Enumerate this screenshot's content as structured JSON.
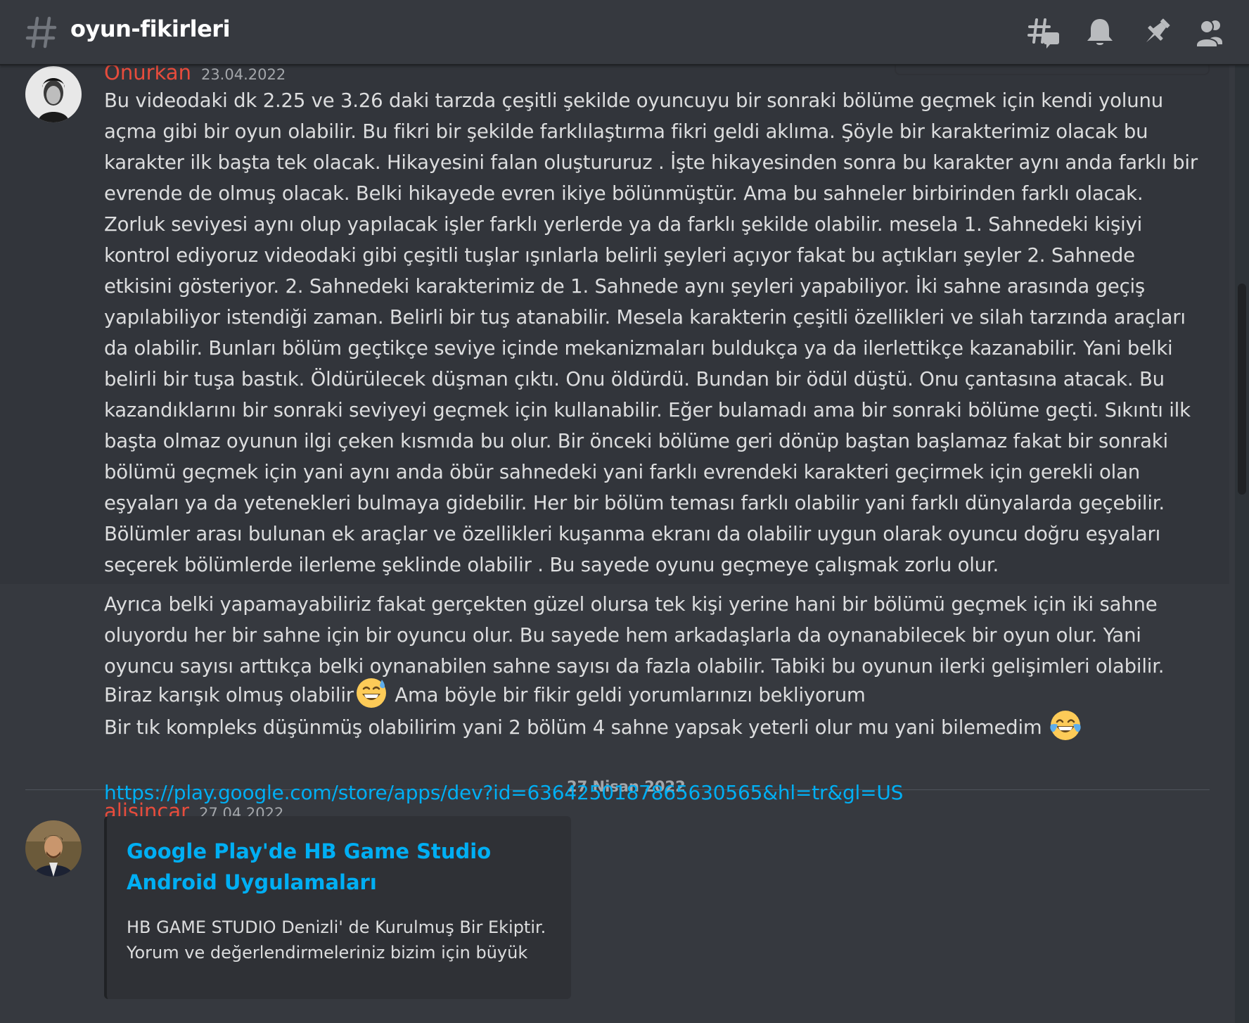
{
  "header": {
    "channel_name": "oyun-fikirleri",
    "icons": [
      "hash-icon",
      "threads-icon",
      "bell-icon",
      "pin-icon",
      "members-icon"
    ]
  },
  "messages": [
    {
      "author": "Onurkan",
      "timestamp": "23.04.2022",
      "paragraphs": [
        "Bu videodaki dk 2.25 ve 3.26 daki tarzda çeşitli şekilde oyuncuyu bir sonraki bölüme geçmek için kendi yolunu açma gibi bir oyun olabilir. Bu fikri bir şekilde farklılaştırma fikri geldi aklıma. Şöyle bir karakterimiz olacak bu karakter ilk başta tek olacak. Hikayesini falan oluştururuz . İşte hikayesinden sonra bu karakter aynı anda farklı bir evrende de olmuş olacak. Belki hikayede evren ikiye bölünmüştür.  Ama bu sahneler birbirinden farklı olacak. Zorluk seviyesi aynı olup yapılacak işler farklı yerlerde ya da farklı şekilde olabilir. mesela 1. Sahnedeki kişiyi kontrol ediyoruz videodaki gibi çeşitli tuşlar ışınlarla belirli şeyleri açıyor fakat bu açtıkları şeyler 2. Sahnede etkisini gösteriyor. 2. Sahnedeki karakterimiz de 1. Sahnede aynı şeyleri yapabiliyor. İki sahne arasında geçiş yapılabiliyor istendiği zaman. Belirli bir tuş atanabilir. Mesela karakterin çeşitli özellikleri ve silah tarzında araçları da olabilir. Bunları bölüm geçtikçe seviye içinde mekanizmaları buldukça ya da ilerlettikçe kazanabilir. Yani belki belirli bir tuşa bastık. Öldürülecek düşman çıktı. Onu öldürdü. Bundan bir ödül düştü. Onu çantasına atacak. Bu kazandıklarını bir sonraki seviyeyi geçmek için kullanabilir. Eğer bulamadı ama bir sonraki bölüme geçti. Sıkıntı ilk başta olmaz oyunun ilgi çeken kısmıda bu olur. Bir önceki bölüme geri dönüp baştan başlamaz fakat bir sonraki bölümü geçmek için yani aynı anda öbür sahnedeki yani farklı evrendeki karakteri geçirmek için gerekli olan eşyaları ya da yetenekleri bulmaya gidebilir. Her bir bölüm teması farklı olabilir yani farklı dünyalarda geçebilir. Bölümler arası bulunan ek araçlar ve özellikleri kuşanma ekranı da olabilir uygun olarak oyuncu doğru eşyaları seçerek bölümlerde ilerleme şeklinde olabilir . Bu sayede oyunu geçmeye çalışmak zorlu olur.",
        "Ayrıca belki yapamayabiliriz fakat gerçekten güzel olursa tek kişi yerine hani bir bölümü geçmek için iki sahne oluyordu her bir sahne için bir oyuncu olur. Bu sayede hem arkadaşlarla da oynanabilecek bir oyun olur. Yani oyuncu sayısı arttıkça belki oynanabilen sahne sayısı da fazla olabilir. Tabiki bu oyunun ilerki gelişimleri olabilir."
      ],
      "line_a": {
        "before": "Biraz karışık olmuş olabilir",
        "emoji": "sweat-smile-emoji",
        "after": " Ama böyle bir fikir geldi yorumlarınızı bekliyorum"
      },
      "line_b": {
        "text": "Bir tık kompleks düşünmüş olabilirim yani 2 bölüm 4 sahne yapsak yeterli olur mu yani bilemedim ",
        "emoji": "joy-emoji"
      }
    },
    {
      "author": "alisincar",
      "timestamp": "27.04.2022",
      "link": "https://play.google.com/store/apps/dev?id=6364250187865630565&hl=tr&gl=US",
      "embed": {
        "title": "Google Play'de HB Game Studio Android Uygulamaları",
        "description": "HB GAME STUDIO Denizli' de Kurulmuş Bir Ekiptir. Yorum ve değerlendirmeleriniz bizim için büyük"
      }
    }
  ],
  "date_divider": "27 Nisan 2022",
  "colors": {
    "background": "#36393f",
    "username": "#e74c3c",
    "link": "#00aff4",
    "text": "#dcddde",
    "muted": "#a3a6aa"
  }
}
